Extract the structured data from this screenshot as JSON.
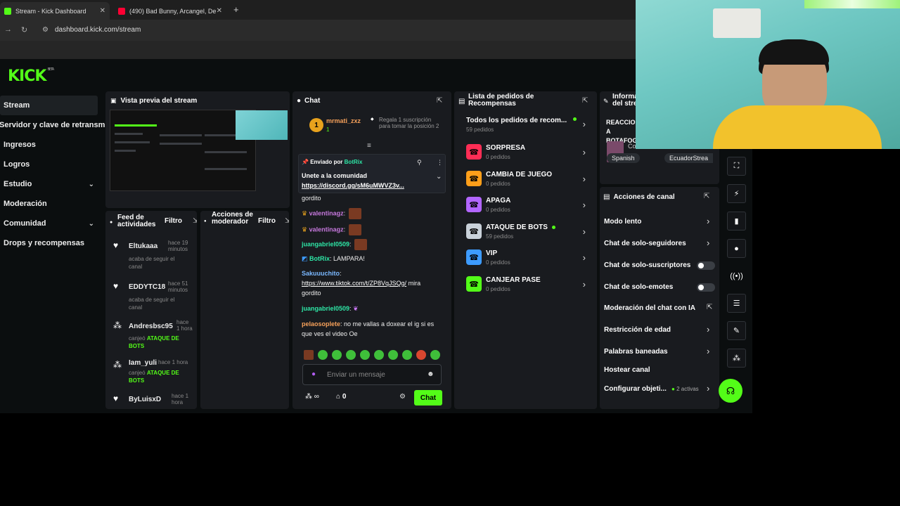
{
  "browser": {
    "tabs": [
      {
        "title": "Stream - Kick Dashboard",
        "active": true,
        "favicon_color": "#53fc18"
      },
      {
        "title": "(490) Bad Bunny, Arcangel, De",
        "active": false,
        "favicon_color": "#ff0033"
      }
    ],
    "url": "dashboard.kick.com/stream"
  },
  "logo": "KICK",
  "logo_badge": "BETA",
  "sidebar": {
    "items": [
      {
        "label": "Stream",
        "active": true,
        "expandable": false
      },
      {
        "label": "Servidor y clave de retransmisión",
        "active": false,
        "expandable": false
      },
      {
        "label": "Ingresos",
        "active": false,
        "expandable": false
      },
      {
        "label": "Logros",
        "active": false,
        "expandable": false
      },
      {
        "label": "Estudio",
        "active": false,
        "expandable": true
      },
      {
        "label": "Moderación",
        "active": false,
        "expandable": false
      },
      {
        "label": "Comunidad",
        "active": false,
        "expandable": true
      },
      {
        "label": "Drops y recompensas",
        "active": false,
        "expandable": false
      }
    ]
  },
  "preview": {
    "title": "Vista previa del stream"
  },
  "feed": {
    "title": "Feed de actividades",
    "filter": "Filtro",
    "items": [
      {
        "icon": "heart-icon",
        "name": "Eltukaaa",
        "time": "hace 19 minutos",
        "desc": "acaba de seguir el canal",
        "reward": ""
      },
      {
        "icon": "heart-icon",
        "name": "EDDYTC18",
        "time": "hace 51 minutos",
        "desc": "acaba de seguir el canal",
        "reward": ""
      },
      {
        "icon": "redeem-icon",
        "name": "Andresbsc95",
        "time": "hace 1 hora",
        "desc": "canjeó",
        "reward": "ATAQUE DE BOTS"
      },
      {
        "icon": "redeem-icon",
        "name": "Iam_yuli",
        "time": "hace 1 hora",
        "desc": "canjeó",
        "reward": "ATAQUE DE BOTS"
      },
      {
        "icon": "heart-icon",
        "name": "ByLuisxD",
        "time": "hace 1 hora",
        "desc": "",
        "reward": ""
      }
    ]
  },
  "mod_actions": {
    "title": "Acciones de moderador",
    "filter": "Filtro"
  },
  "chat": {
    "title": "Chat",
    "gift": {
      "user": "mrmati_zxz",
      "count": "1",
      "text": "Regala 1 suscripción para tomar la posición 2"
    },
    "pinned": {
      "label": "Enviado por",
      "user": "BotRix",
      "text": "Unete a la comunidad",
      "link": "https://discord.gg/sM6uMWVZ3v..."
    },
    "messages": [
      {
        "user": "",
        "text": "gordito",
        "color": ""
      },
      {
        "user": "valentinagz",
        "text": "",
        "color": "pink"
      },
      {
        "user": "valentinagz",
        "text": "",
        "color": "pink"
      },
      {
        "user": "juangabriel0509",
        "text": "",
        "color": "green"
      },
      {
        "user": "BotRix",
        "text": "LAMPARA!",
        "color": "green"
      },
      {
        "user": "Sakuuuchito",
        "text": "https://www.tiktok.com/t/ZP8VqJSQg/",
        "text2": "mira gordito",
        "color": "blue"
      },
      {
        "user": "juangabriel0509",
        "text": "",
        "color": "green"
      },
      {
        "user": "pelaosoplete",
        "text": "no me vallas a doxear el ig si es que ves el video Oe",
        "color": "orange"
      }
    ],
    "input_placeholder": "Enviar un mensaje",
    "points": "0",
    "send": "Chat"
  },
  "rewards": {
    "title": "Lista de pedidos de Recompensas",
    "all_label": "Todos los pedidos de recom...",
    "all_count": "59 pedidos",
    "items": [
      {
        "name": "SORPRESA",
        "count": "0 pedidos",
        "color": "#ff2d55",
        "dot": false
      },
      {
        "name": "CAMBIA DE JUEGO",
        "count": "0 pedidos",
        "color": "#ff9f1a",
        "dot": false
      },
      {
        "name": "APAGA",
        "count": "0 pedidos",
        "color": "#b266ff",
        "dot": false
      },
      {
        "name": "ATAQUE DE BOTS",
        "count": "59 pedidos",
        "color": "#c9d1d9",
        "dot": true
      },
      {
        "name": "VIP",
        "count": "0 pedidos",
        "color": "#3d9bff",
        "dot": false
      },
      {
        "name": "CANJEAR PASE",
        "count": "0 pedidos",
        "color": "#53fc18",
        "dot": false
      }
    ]
  },
  "info": {
    "title": "Información del stream",
    "stream_title": "REACCIONANDO A BOTAFOGO",
    "category": "Conversación",
    "tags": [
      "Spanish",
      "EcuadorStrea"
    ]
  },
  "channel_actions": {
    "title": "Acciones de canal",
    "items": [
      {
        "label": "Modo lento",
        "type": "arrow"
      },
      {
        "label": "Chat de solo-seguidores",
        "type": "arrow"
      },
      {
        "label": "Chat de solo-suscriptores",
        "type": "toggle"
      },
      {
        "label": "Chat de solo-emotes",
        "type": "toggle"
      },
      {
        "label": "Moderación del chat con IA",
        "type": "external"
      },
      {
        "label": "Restricción de edad",
        "type": "arrow"
      },
      {
        "label": "Palabras baneadas",
        "type": "arrow"
      },
      {
        "label": "Hostear canal",
        "type": "none"
      },
      {
        "label": "Configurar objeti...",
        "type": "arrow",
        "extra": "2 activas"
      }
    ]
  },
  "colors": {
    "accent": "#53fc18",
    "panel": "#191b1f",
    "bg": "#0b0e0f"
  }
}
